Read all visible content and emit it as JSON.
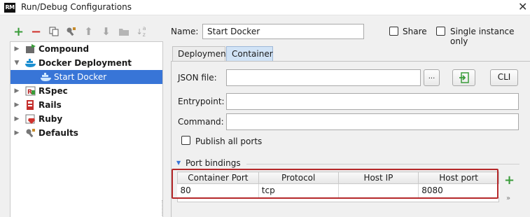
{
  "window": {
    "app_icon_text": "RM",
    "title": "Run/Debug Configurations",
    "close_symbol": "✕"
  },
  "toolbar": {
    "icons": [
      "plus-icon",
      "minus-icon",
      "copy-icon",
      "wrench-icon",
      "arrow-up-icon",
      "arrow-down-icon",
      "folder-icon",
      "sort-az-icon"
    ]
  },
  "tree": {
    "items": [
      {
        "label": "Compound",
        "icon": "compound-icon",
        "expanded": false
      },
      {
        "label": "Docker Deployment",
        "icon": "docker-icon",
        "expanded": true
      },
      {
        "label": "Start Docker",
        "icon": "docker-icon",
        "selected": true
      },
      {
        "label": "RSpec",
        "icon": "rspec-icon",
        "expanded": false
      },
      {
        "label": "Rails",
        "icon": "rails-icon",
        "expanded": false
      },
      {
        "label": "Ruby",
        "icon": "ruby-icon",
        "expanded": false
      },
      {
        "label": "Defaults",
        "icon": "wrench-icon",
        "expanded": false
      }
    ]
  },
  "form": {
    "name_label": "Name:",
    "name_value": "Start Docker",
    "share_label": "Share",
    "single_instance_label": "Single instance only"
  },
  "tabs": [
    {
      "label": "Deployment",
      "active": false
    },
    {
      "label": "Container",
      "active": true
    }
  ],
  "container": {
    "json_file_label": "JSON file:",
    "json_file_value": "",
    "browse_label": "...",
    "cli_label": "CLI",
    "entrypoint_label": "Entrypoint:",
    "entrypoint_value": "",
    "command_label": "Command:",
    "command_value": "",
    "publish_all_ports_label": "Publish all ports",
    "port_bindings_label": "Port bindings",
    "columns": [
      "Container Port",
      "Protocol",
      "Host IP",
      "Host port"
    ],
    "rows": [
      {
        "container_port": "80",
        "protocol": "tcp",
        "host_ip": "",
        "host_port": "8080"
      }
    ],
    "add_symbol": "+",
    "more_symbol": "»"
  },
  "colors": {
    "selection": "#3875d7",
    "highlight_border": "#b5282a",
    "add_green": "#3a9c3a",
    "remove_red": "#d0332e"
  }
}
